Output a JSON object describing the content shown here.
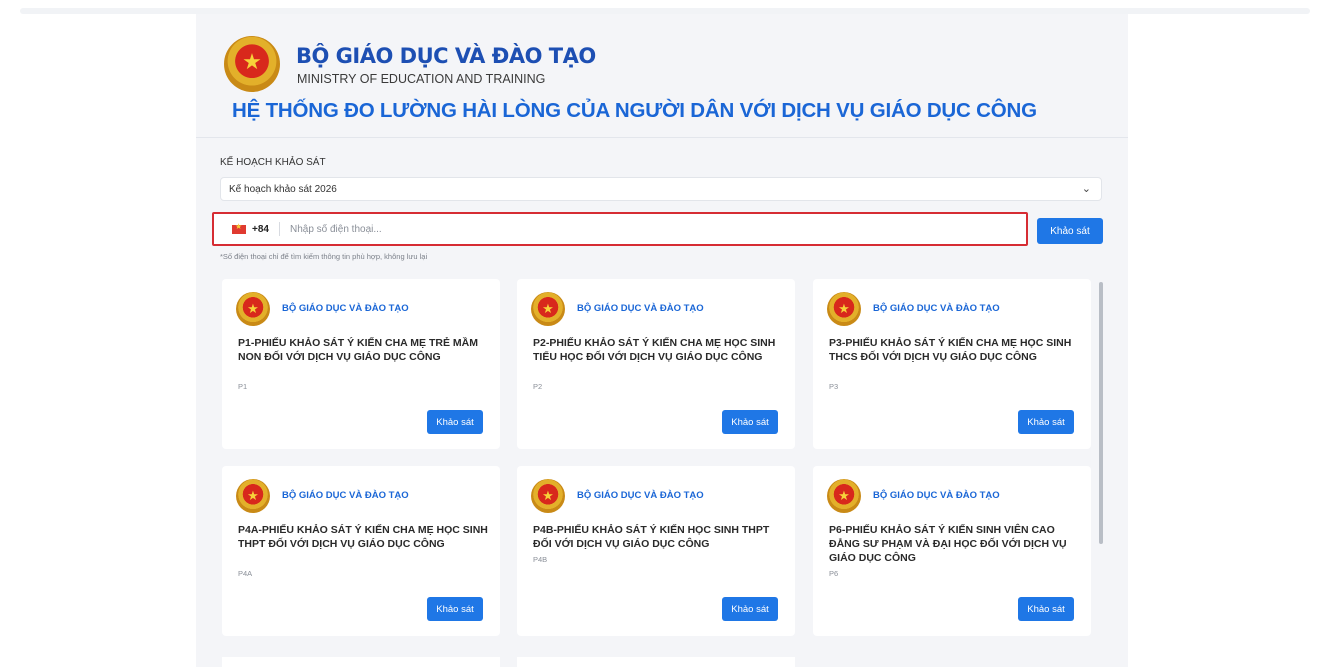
{
  "header": {
    "ministry_vn": "BỘ GIÁO DỤC VÀ ĐÀO TẠO",
    "ministry_en": "MINISTRY OF EDUCATION AND TRAINING",
    "system_title": "HỆ THỐNG ĐO LƯỜNG HÀI LÒNG CỦA NGƯỜI DÂN VỚI DỊCH VỤ GIÁO DỤC CÔNG"
  },
  "plan": {
    "label": "KẾ HOẠCH KHẢO SÁT",
    "selected": "Kế hoạch khảo sát 2026"
  },
  "phone": {
    "dial_code": "+84",
    "placeholder": "Nhập số điện thoại...",
    "value": "",
    "submit_label": "Khảo sát",
    "hint": "*Số điện thoại chỉ để tìm kiếm thông tin phù hợp, không lưu lại"
  },
  "cards": [
    {
      "org": "BỘ GIÁO DỤC VÀ ĐÀO TẠO",
      "title": "P1-PHIẾU KHẢO SÁT Ý KIẾN CHA MẸ TRẺ MẦM NON ĐỐI VỚI DỊCH VỤ GIÁO DỤC CÔNG",
      "code": "P1",
      "button": "Khảo sát"
    },
    {
      "org": "BỘ GIÁO DỤC VÀ ĐÀO TẠO",
      "title": "P2-PHIẾU KHẢO SÁT Ý KIẾN CHA MẸ HỌC SINH TIỂU HỌC ĐỐI VỚI DỊCH VỤ GIÁO DỤC CÔNG",
      "code": "P2",
      "button": "Khảo sát"
    },
    {
      "org": "BỘ GIÁO DỤC VÀ ĐÀO TẠO",
      "title": "P3-PHIẾU KHẢO SÁT Ý KIẾN CHA MẸ HỌC SINH THCS ĐỐI VỚI DỊCH VỤ GIÁO DỤC CÔNG",
      "code": "P3",
      "button": "Khảo sát"
    },
    {
      "org": "BỘ GIÁO DỤC VÀ ĐÀO TẠO",
      "title": "P4A-PHIẾU KHẢO SÁT Ý KIẾN CHA MẸ HỌC SINH THPT ĐỐI VỚI DỊCH VỤ GIÁO DỤC CÔNG",
      "code": "P4A",
      "button": "Khảo sát"
    },
    {
      "org": "BỘ GIÁO DỤC VÀ ĐÀO TẠO",
      "title": "P4B-PHIẾU KHẢO SÁT Ý KIẾN HỌC SINH THPT ĐỐI VỚI DỊCH VỤ GIÁO DỤC CÔNG",
      "code": "P4B",
      "button": "Khảo sát"
    },
    {
      "org": "BỘ GIÁO DỤC VÀ ĐÀO TẠO",
      "title": "P6-PHIẾU KHẢO SÁT Ý KIẾN SINH VIÊN CAO ĐẲNG SƯ PHẠM VÀ ĐẠI HỌC ĐỐI VỚI DỊCH VỤ GIÁO DỤC CÔNG",
      "code": "P6",
      "button": "Khảo sát"
    }
  ],
  "colors": {
    "accent": "#1f77e6",
    "title_blue": "#1a66d6",
    "error_border": "#d62c33",
    "panel_bg": "#f4f5f8"
  },
  "icons": {
    "emblem": "national-emblem-icon",
    "flag": "vietnam-flag-icon",
    "chevron": "chevron-down-icon"
  }
}
